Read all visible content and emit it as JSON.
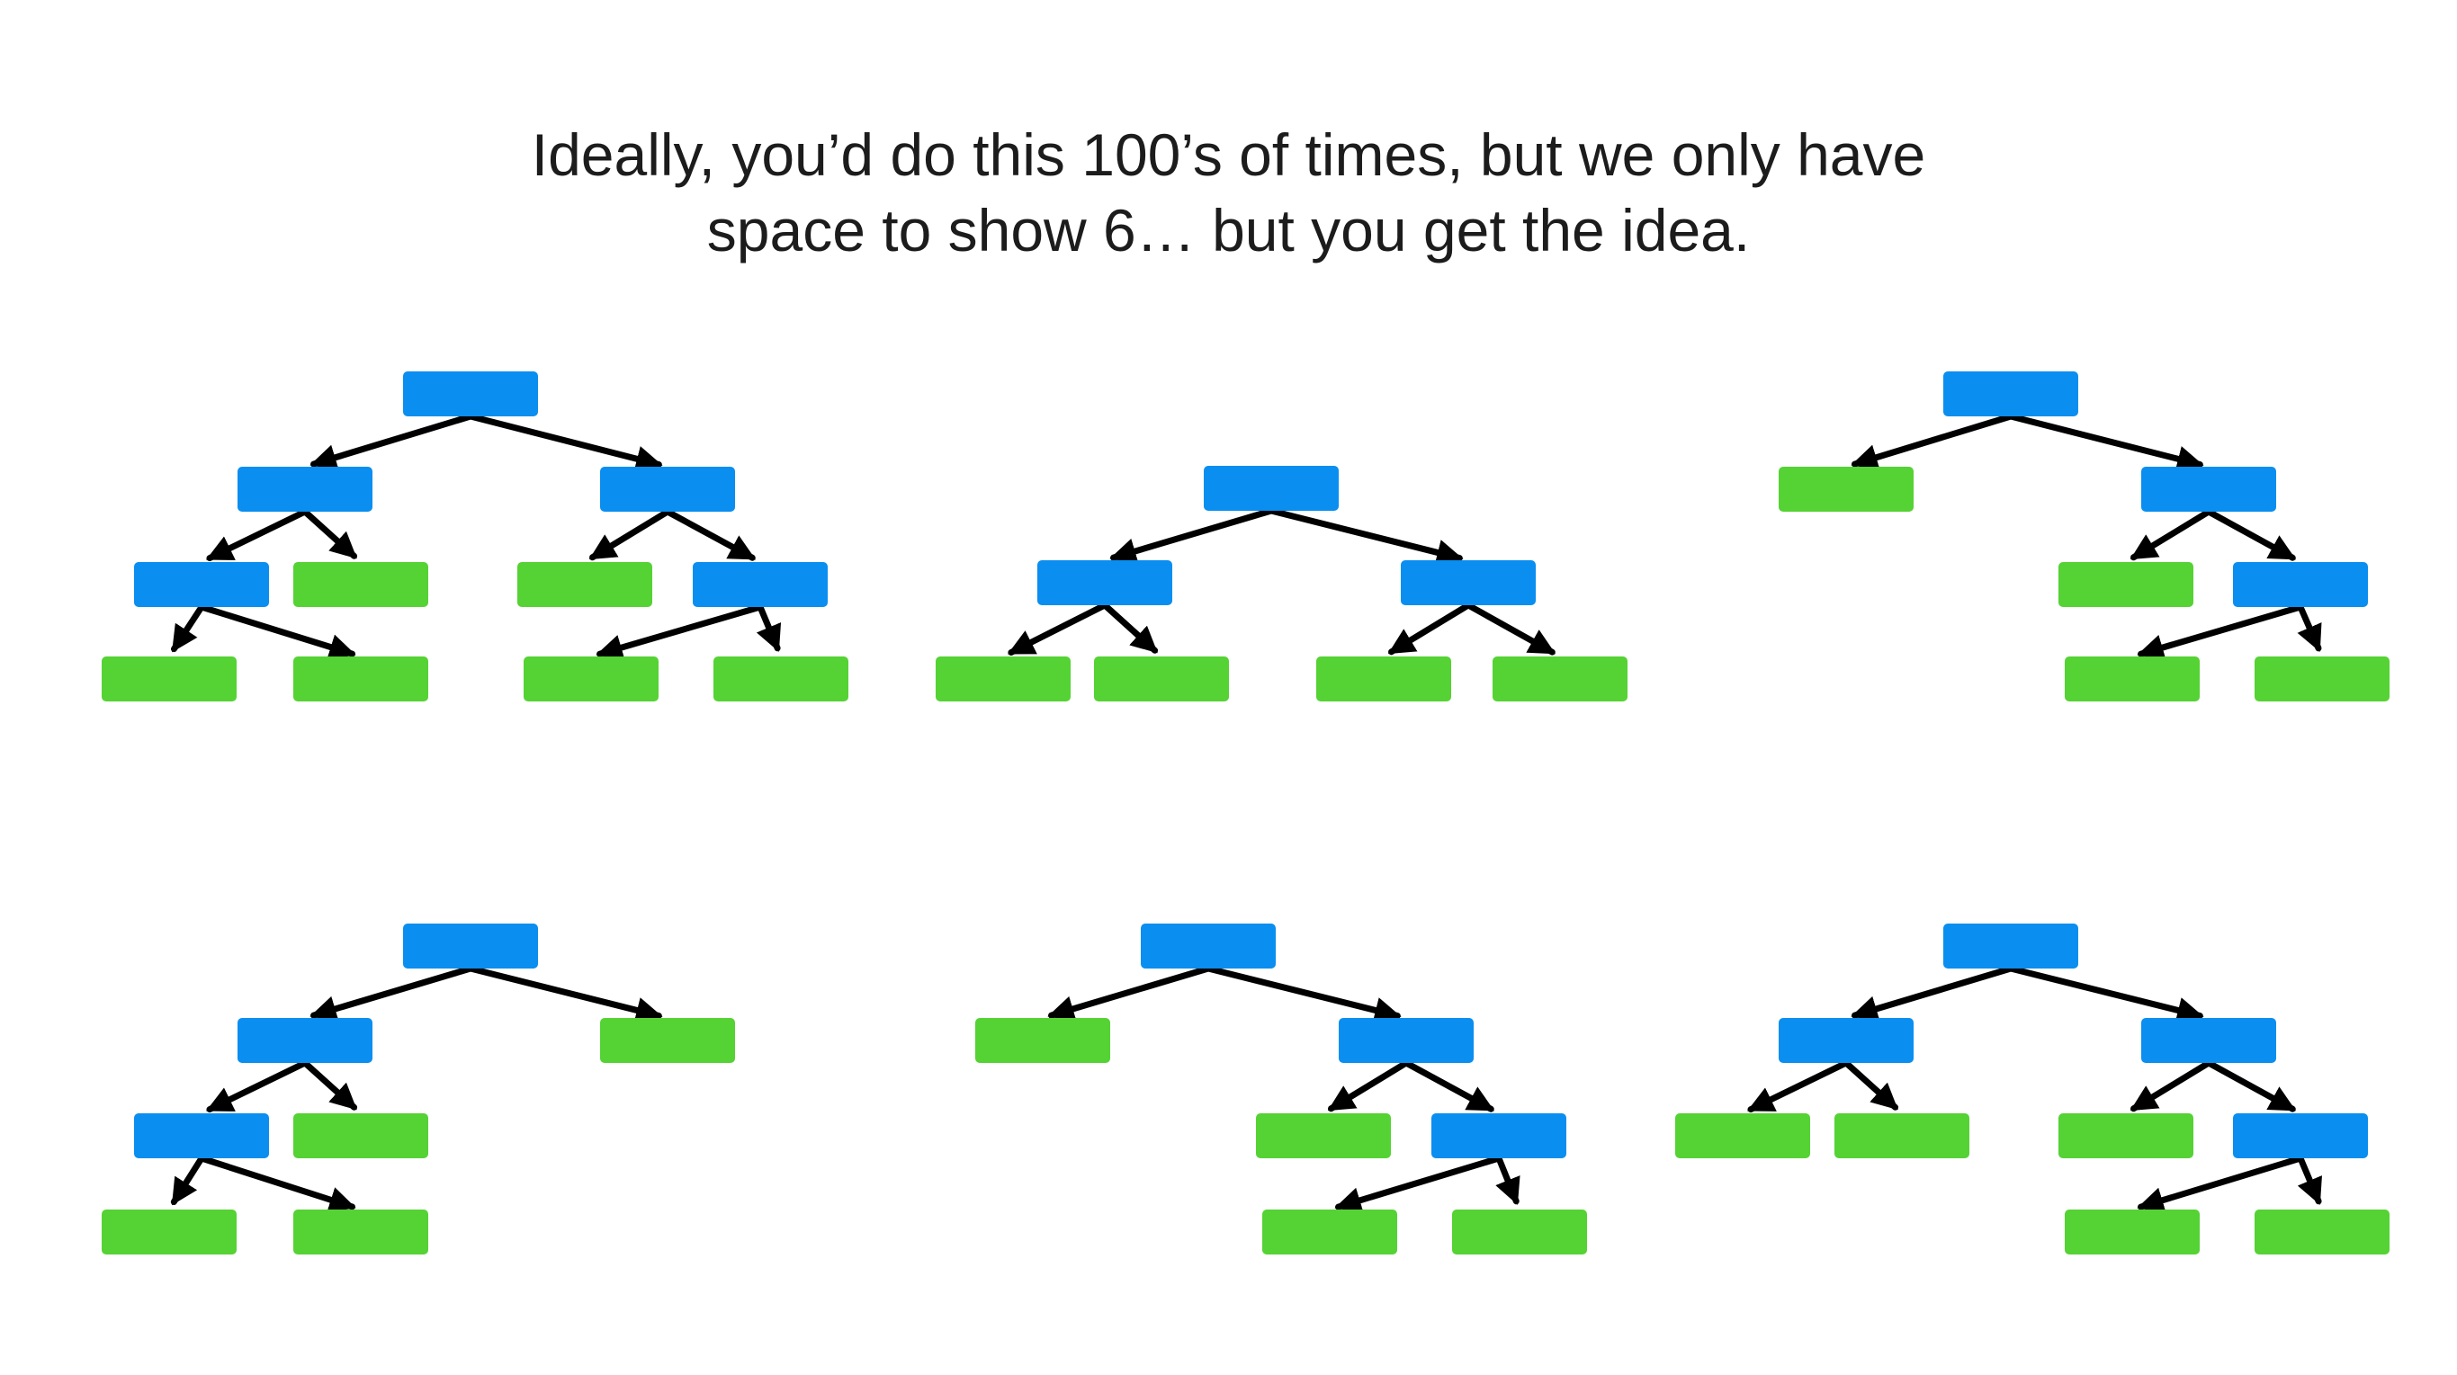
{
  "caption": {
    "line1": "Ideally, you’d do this 100’s of times, but we only have",
    "line2": "space to show 6… but you get the idea."
  },
  "colors": {
    "internal_node": "#0a8ef0",
    "leaf_node": "#55d234",
    "edge": "#000000",
    "background": "#ffffff"
  },
  "trees": [
    {
      "name": "tree-1",
      "nodes": [
        {
          "id": "root",
          "kind": "internal"
        },
        {
          "id": "l",
          "kind": "internal"
        },
        {
          "id": "r",
          "kind": "internal"
        },
        {
          "id": "ll",
          "kind": "internal"
        },
        {
          "id": "lr",
          "kind": "leaf"
        },
        {
          "id": "rl",
          "kind": "leaf"
        },
        {
          "id": "rr",
          "kind": "internal"
        },
        {
          "id": "lll",
          "kind": "leaf"
        },
        {
          "id": "llr",
          "kind": "leaf"
        },
        {
          "id": "rrl",
          "kind": "leaf"
        },
        {
          "id": "rrr",
          "kind": "leaf"
        }
      ],
      "edges": [
        [
          "root",
          "l"
        ],
        [
          "root",
          "r"
        ],
        [
          "l",
          "ll"
        ],
        [
          "l",
          "lr"
        ],
        [
          "r",
          "rl"
        ],
        [
          "r",
          "rr"
        ],
        [
          "ll",
          "lll"
        ],
        [
          "ll",
          "llr"
        ],
        [
          "rr",
          "rrl"
        ],
        [
          "rr",
          "rrr"
        ]
      ]
    },
    {
      "name": "tree-2",
      "nodes": [
        {
          "id": "root",
          "kind": "internal"
        },
        {
          "id": "l",
          "kind": "internal"
        },
        {
          "id": "r",
          "kind": "internal"
        },
        {
          "id": "ll",
          "kind": "leaf"
        },
        {
          "id": "lr",
          "kind": "leaf"
        },
        {
          "id": "rl",
          "kind": "leaf"
        },
        {
          "id": "rr",
          "kind": "leaf"
        }
      ],
      "edges": [
        [
          "root",
          "l"
        ],
        [
          "root",
          "r"
        ],
        [
          "l",
          "ll"
        ],
        [
          "l",
          "lr"
        ],
        [
          "r",
          "rl"
        ],
        [
          "r",
          "rr"
        ]
      ]
    },
    {
      "name": "tree-3",
      "nodes": [
        {
          "id": "root",
          "kind": "internal"
        },
        {
          "id": "l",
          "kind": "leaf"
        },
        {
          "id": "r",
          "kind": "internal"
        },
        {
          "id": "rl",
          "kind": "leaf"
        },
        {
          "id": "rr",
          "kind": "internal"
        },
        {
          "id": "rrl",
          "kind": "leaf"
        },
        {
          "id": "rrr",
          "kind": "leaf"
        }
      ],
      "edges": [
        [
          "root",
          "l"
        ],
        [
          "root",
          "r"
        ],
        [
          "r",
          "rl"
        ],
        [
          "r",
          "rr"
        ],
        [
          "rr",
          "rrl"
        ],
        [
          "rr",
          "rrr"
        ]
      ]
    },
    {
      "name": "tree-4",
      "nodes": [
        {
          "id": "root",
          "kind": "internal"
        },
        {
          "id": "l",
          "kind": "internal"
        },
        {
          "id": "r",
          "kind": "leaf"
        },
        {
          "id": "ll",
          "kind": "internal"
        },
        {
          "id": "lr",
          "kind": "leaf"
        },
        {
          "id": "lll",
          "kind": "leaf"
        },
        {
          "id": "llr",
          "kind": "leaf"
        }
      ],
      "edges": [
        [
          "root",
          "l"
        ],
        [
          "root",
          "r"
        ],
        [
          "l",
          "ll"
        ],
        [
          "l",
          "lr"
        ],
        [
          "ll",
          "lll"
        ],
        [
          "ll",
          "llr"
        ]
      ]
    },
    {
      "name": "tree-5",
      "nodes": [
        {
          "id": "root",
          "kind": "internal"
        },
        {
          "id": "l",
          "kind": "leaf"
        },
        {
          "id": "r",
          "kind": "internal"
        },
        {
          "id": "rl",
          "kind": "leaf"
        },
        {
          "id": "rr",
          "kind": "internal"
        },
        {
          "id": "rrl",
          "kind": "leaf"
        },
        {
          "id": "rrr",
          "kind": "leaf"
        }
      ],
      "edges": [
        [
          "root",
          "l"
        ],
        [
          "root",
          "r"
        ],
        [
          "r",
          "rl"
        ],
        [
          "r",
          "rr"
        ],
        [
          "rr",
          "rrl"
        ],
        [
          "rr",
          "rrr"
        ]
      ]
    },
    {
      "name": "tree-6",
      "nodes": [
        {
          "id": "root",
          "kind": "internal"
        },
        {
          "id": "l",
          "kind": "internal"
        },
        {
          "id": "r",
          "kind": "internal"
        },
        {
          "id": "ll",
          "kind": "leaf"
        },
        {
          "id": "lr",
          "kind": "leaf"
        },
        {
          "id": "rl",
          "kind": "leaf"
        },
        {
          "id": "rr",
          "kind": "internal"
        },
        {
          "id": "rrl",
          "kind": "leaf"
        },
        {
          "id": "rrr",
          "kind": "leaf"
        }
      ],
      "edges": [
        [
          "root",
          "l"
        ],
        [
          "root",
          "r"
        ],
        [
          "l",
          "ll"
        ],
        [
          "l",
          "lr"
        ],
        [
          "r",
          "rl"
        ],
        [
          "r",
          "rr"
        ],
        [
          "rr",
          "rrl"
        ],
        [
          "rr",
          "rrr"
        ]
      ]
    }
  ]
}
